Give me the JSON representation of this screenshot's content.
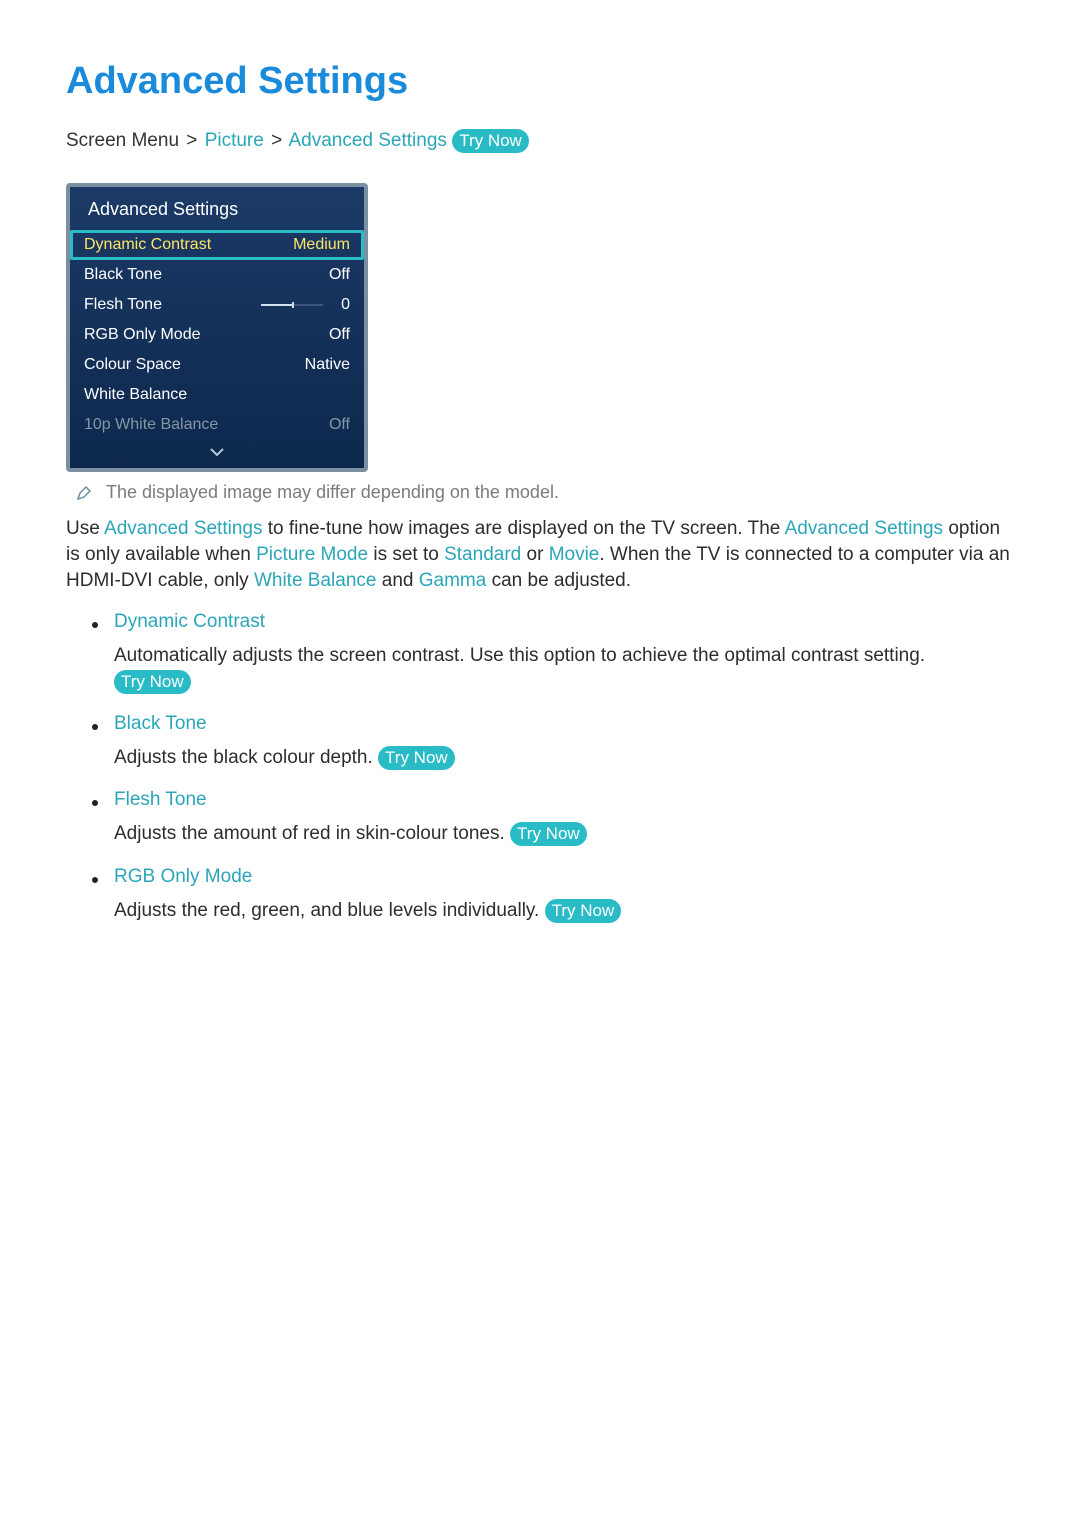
{
  "heading": "Advanced Settings",
  "breadcrumb": {
    "root": "Screen Menu",
    "a": "Picture",
    "b": "Advanced Settings",
    "try": "Try Now"
  },
  "panel": {
    "title": "Advanced Settings",
    "rows": {
      "dynamic_contrast": {
        "label": "Dynamic Contrast",
        "value": "Medium"
      },
      "black_tone": {
        "label": "Black Tone",
        "value": "Off"
      },
      "flesh_tone": {
        "label": "Flesh Tone",
        "value": "0"
      },
      "rgb_only": {
        "label": "RGB Only Mode",
        "value": "Off"
      },
      "colour_space": {
        "label": "Colour Space",
        "value": "Native"
      },
      "white_balance": {
        "label": "White Balance",
        "value": ""
      },
      "p10": {
        "label": "10p White Balance",
        "value": "Off"
      }
    }
  },
  "note": "The displayed image may differ depending on the model.",
  "para": {
    "p1a": "Use ",
    "p1b": "Advanced Settings",
    "p1c": " to fine-tune how images are displayed on the TV screen. The ",
    "p1d": "Advanced Settings",
    "p1e": " option is only available when ",
    "p1f": "Picture Mode",
    "p1g": " is set to ",
    "p1h": "Standard",
    "p1i": " or ",
    "p1j": "Movie",
    "p1k": ". When the TV is connected to a computer via an HDMI-DVI cable, only ",
    "p1l": "White Balance",
    "p1m": " and ",
    "p1n": "Gamma",
    "p1o": " can be adjusted."
  },
  "items": {
    "dc": {
      "title": "Dynamic Contrast",
      "body": "Automatically adjusts the screen contrast. Use this option to achieve the optimal contrast setting.",
      "try": "Try Now"
    },
    "bt": {
      "title": "Black Tone",
      "body": "Adjusts the black colour depth. ",
      "try": "Try Now"
    },
    "ft": {
      "title": "Flesh Tone",
      "body": "Adjusts the amount of red in skin-colour tones. ",
      "try": "Try Now"
    },
    "rgb": {
      "title": "RGB Only Mode",
      "body": "Adjusts the red, green, and blue levels individually. ",
      "try": "Try Now"
    }
  }
}
